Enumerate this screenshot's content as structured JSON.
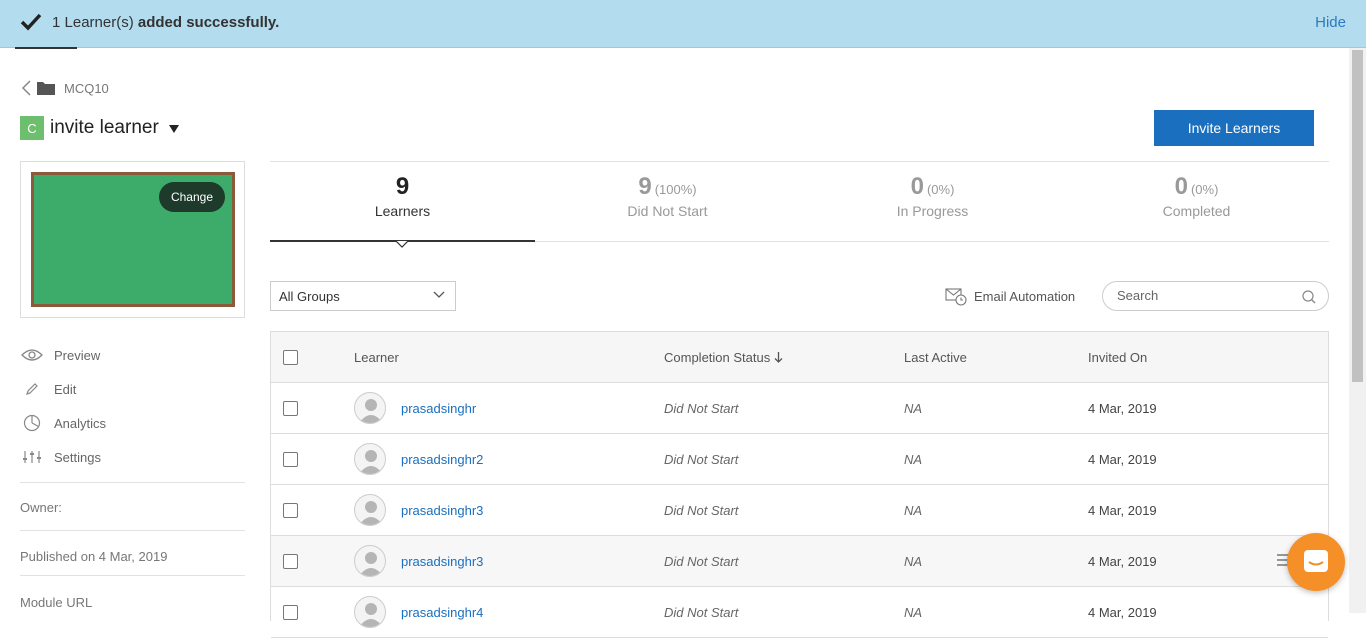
{
  "banner": {
    "count_text": "1 Learner(s)",
    "success_text": "added successfully.",
    "hide_label": "Hide"
  },
  "breadcrumb": {
    "folder_name": "MCQ10"
  },
  "module": {
    "badge": "C",
    "title": "invite learner"
  },
  "invite_button": "Invite Learners",
  "thumbnail": {
    "change_label": "Change"
  },
  "menu": {
    "preview": "Preview",
    "edit": "Edit",
    "analytics": "Analytics",
    "settings": "Settings"
  },
  "meta": {
    "owner": "Owner:",
    "published": "Published on 4 Mar, 2019",
    "module_url": "Module URL"
  },
  "stats": [
    {
      "num": "9",
      "pct": "",
      "label": "Learners"
    },
    {
      "num": "9",
      "pct": "(100%)",
      "label": "Did Not Start"
    },
    {
      "num": "0",
      "pct": "(0%)",
      "label": "In Progress"
    },
    {
      "num": "0",
      "pct": "(0%)",
      "label": "Completed"
    }
  ],
  "filters": {
    "group_value": "All Groups",
    "email_automation": "Email Automation",
    "search_placeholder": "Search"
  },
  "table": {
    "headers": {
      "learner": "Learner",
      "completion": "Completion Status",
      "last_active": "Last Active",
      "invited_on": "Invited On"
    },
    "rows": [
      {
        "name": "prasadsinghr",
        "status": "Did Not Start",
        "last_active": "NA",
        "invited": "4 Mar, 2019"
      },
      {
        "name": "prasadsinghr2",
        "status": "Did Not Start",
        "last_active": "NA",
        "invited": "4 Mar, 2019"
      },
      {
        "name": "prasadsinghr3",
        "status": "Did Not Start",
        "last_active": "NA",
        "invited": "4 Mar, 2019"
      },
      {
        "name": "prasadsinghr3",
        "status": "Did Not Start",
        "last_active": "NA",
        "invited": "4 Mar, 2019"
      },
      {
        "name": "prasadsinghr4",
        "status": "Did Not Start",
        "last_active": "NA",
        "invited": "4 Mar, 2019"
      }
    ]
  },
  "colors": {
    "banner_bg": "#b3dcef",
    "primary": "#1a6fbf",
    "board_green": "#3dab6a",
    "chat_orange": "#f58f27"
  }
}
